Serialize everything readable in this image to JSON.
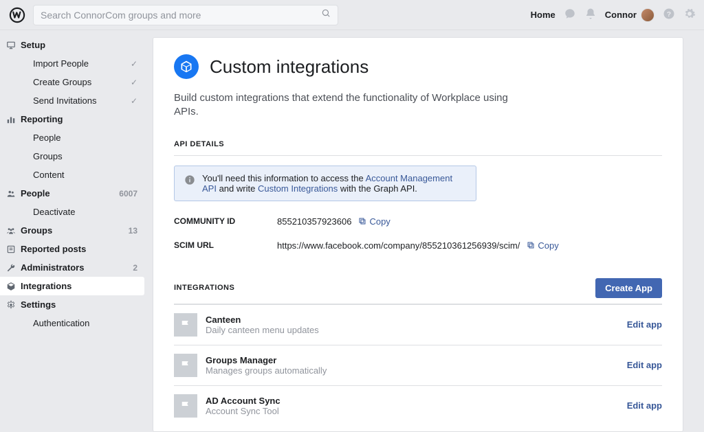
{
  "search": {
    "placeholder": "Search ConnorCom groups and more"
  },
  "topnav": {
    "home": "Home",
    "user": "Connor"
  },
  "sidebar": {
    "setup": {
      "label": "Setup",
      "import": "Import People",
      "create": "Create Groups",
      "send": "Send Invitations"
    },
    "reporting": {
      "label": "Reporting",
      "people": "People",
      "groups": "Groups",
      "content": "Content"
    },
    "people": {
      "label": "People",
      "count": "6007",
      "deactivate": "Deactivate"
    },
    "groups": {
      "label": "Groups",
      "count": "13"
    },
    "reported": {
      "label": "Reported posts"
    },
    "admins": {
      "label": "Administrators",
      "count": "2"
    },
    "integrations": {
      "label": "Integrations"
    },
    "settings": {
      "label": "Settings",
      "auth": "Authentication"
    }
  },
  "page": {
    "title": "Custom integrations",
    "desc": "Build custom integrations that extend the functionality of Workplace using APIs."
  },
  "api": {
    "heading": "API DETAILS",
    "info_pre": "You'll need this information to access the ",
    "info_link1": "Account Management API",
    "info_mid": " and write ",
    "info_link2": "Custom Integrations",
    "info_post": " with the Graph API.",
    "community_label": "COMMUNITY ID",
    "community_value": "855210357923606",
    "scim_label": "SCIM URL",
    "scim_value": "https://www.facebook.com/company/855210361256939/scim/",
    "copy": "Copy"
  },
  "integrations": {
    "heading": "INTEGRATIONS",
    "create": "Create App",
    "edit": "Edit app",
    "items": [
      {
        "name": "Canteen",
        "desc": "Daily canteen menu updates"
      },
      {
        "name": "Groups Manager",
        "desc": "Manages groups automatically"
      },
      {
        "name": "AD Account Sync",
        "desc": "Account Sync Tool"
      }
    ]
  }
}
